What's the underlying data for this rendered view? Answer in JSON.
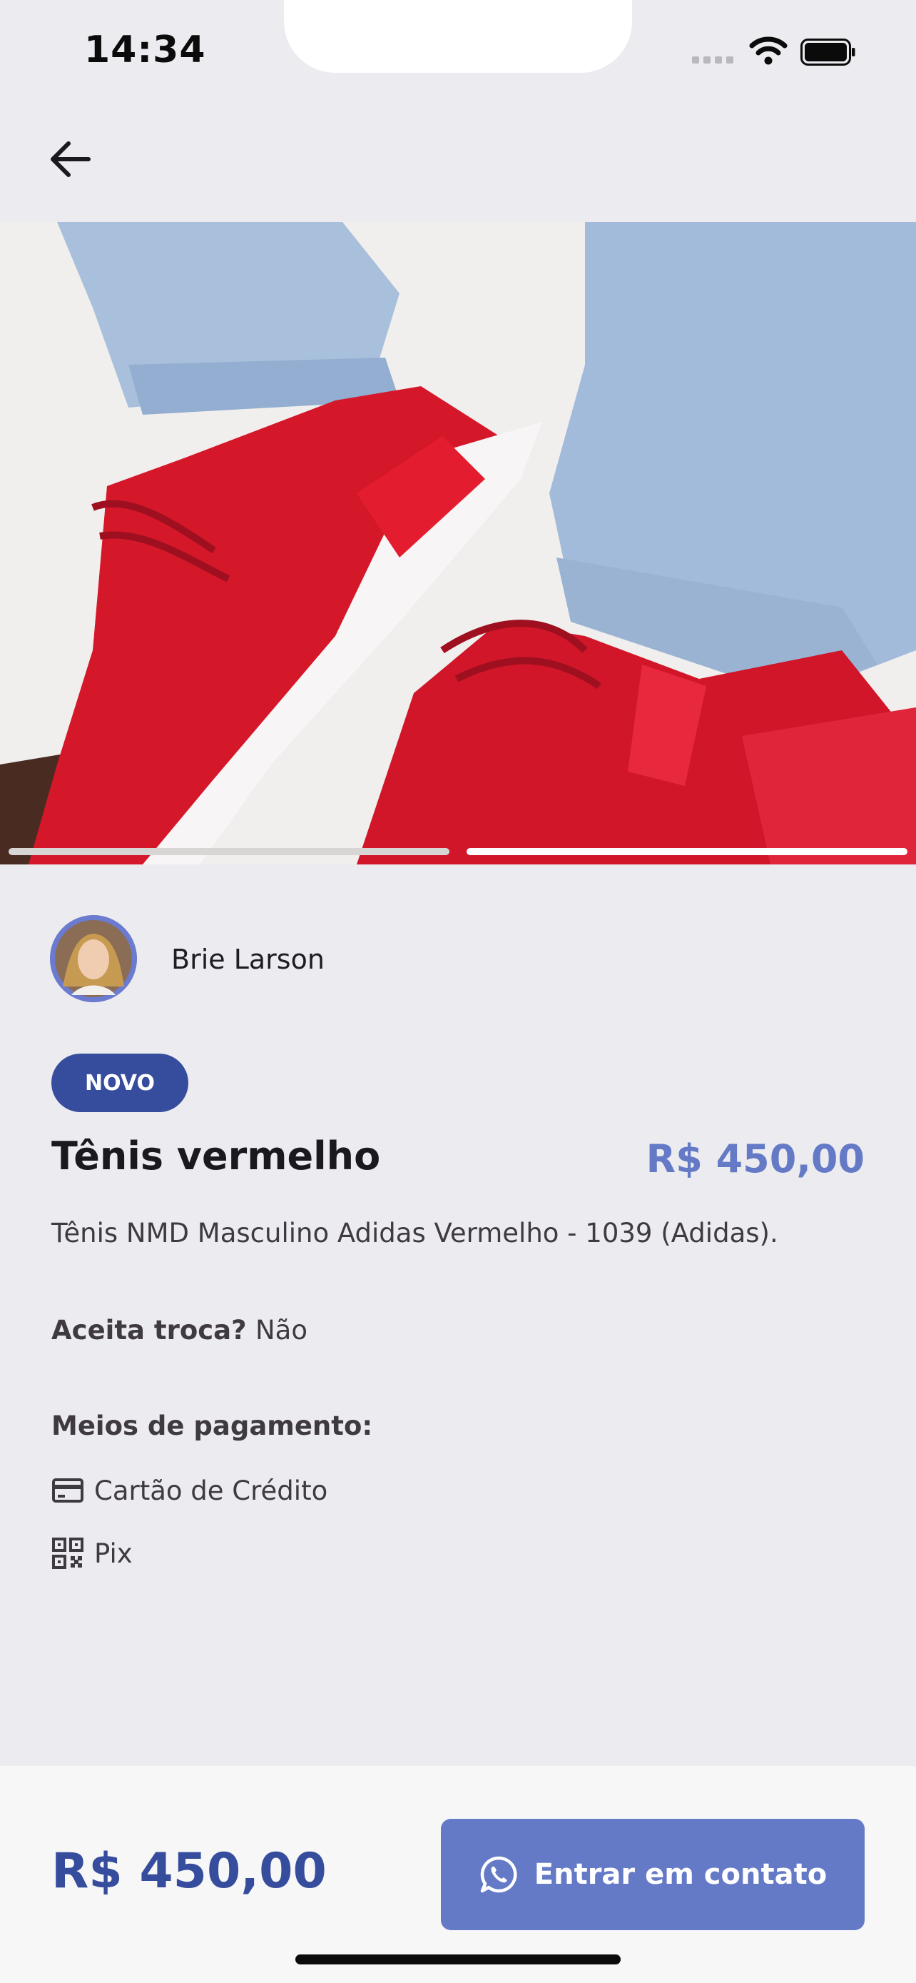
{
  "status_bar": {
    "time": "14:34"
  },
  "icons": {
    "back": "arrow-left-icon",
    "wifi": "wifi-icon",
    "battery": "battery-icon",
    "credit_card": "credit-card-icon",
    "pix": "qr-code-icon",
    "whatsapp": "whatsapp-icon"
  },
  "carousel": {
    "total": 2,
    "active": 2
  },
  "seller": {
    "name": "Brie Larson"
  },
  "product": {
    "condition_badge": "NOVO",
    "title": "Tênis vermelho",
    "price": "R$ 450,00",
    "description": "Tênis NMD Masculino Adidas Vermelho - 1039 (Adidas).",
    "accepts_trade_label": "Aceita troca?",
    "accepts_trade_value": "Não",
    "payment_title": "Meios de pagamento:",
    "payment_methods": [
      {
        "label": "Cartão de Crédito",
        "icon": "credit-card-icon"
      },
      {
        "label": "Pix",
        "icon": "qr-code-icon"
      }
    ]
  },
  "footer": {
    "price": "R$ 450,00",
    "contact_label": "Entrar em contato"
  },
  "colors": {
    "background": "#ECEBEF",
    "primary_dark": "#364D9D",
    "primary_light": "#647AC7",
    "text": "#3E3A40"
  }
}
